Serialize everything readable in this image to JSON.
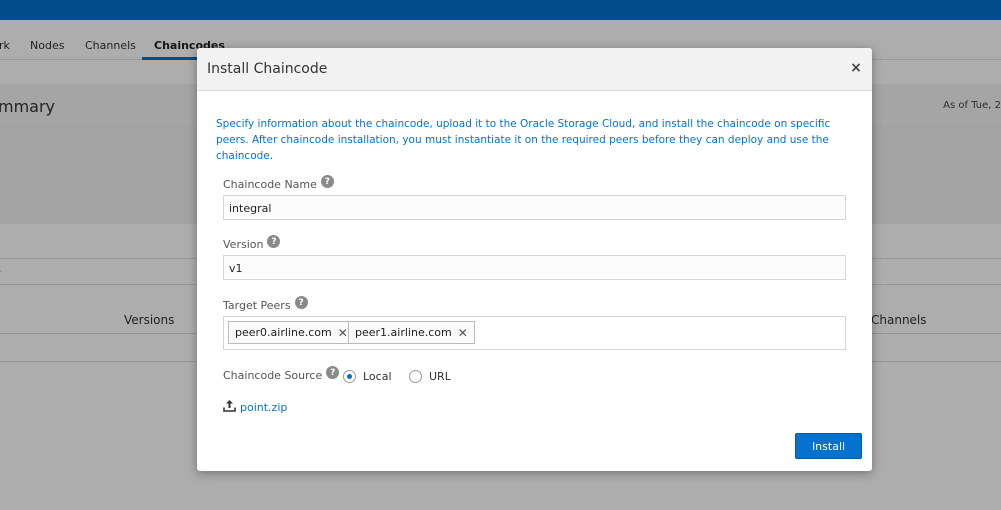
{
  "background": {
    "tabs": [
      "rk",
      "Nodes",
      "Channels",
      "Chaincodes"
    ],
    "summary_title": "mmary",
    "as_of": "As of Tue, 2",
    "row_fragment": ".",
    "columns": {
      "versions": "Versions",
      "channels": "Channels"
    }
  },
  "modal": {
    "title": "Install Chaincode",
    "close": "×",
    "info": "Specify information about the chaincode, upload it to the Oracle Storage Cloud, and install the chaincode on specific peers. After chaincode installation, you must instantiate it on the required peers before they can deploy and use the chaincode.",
    "help_glyph": "?",
    "name_label": "Chaincode Name",
    "name_value": "integral",
    "version_label": "Version",
    "version_value": "v1",
    "peers_label": "Target Peers",
    "peers": [
      "peer0.airline.com",
      "peer1.airline.com"
    ],
    "chip_remove": "✕",
    "source_label": "Chaincode Source",
    "source_options": [
      "Local",
      "URL"
    ],
    "source_selected": "Local",
    "file_name": "point.zip",
    "install_label": "Install"
  },
  "colors": {
    "accent": "#0572ce",
    "topbar": "#0572ce"
  },
  "icons": {
    "upload": "upload-icon",
    "help": "help-icon",
    "close": "close-icon",
    "remove": "remove-chip-icon"
  }
}
